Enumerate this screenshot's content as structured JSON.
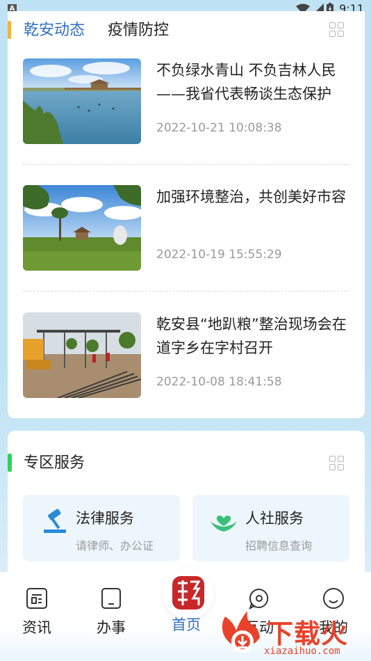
{
  "status_bar": {
    "notification_glyph": "A",
    "time": "9:11",
    "icons": [
      "wifi-icon",
      "signal-icon",
      "battery-icon"
    ]
  },
  "news": {
    "tabs": [
      {
        "label": "乾安动态",
        "active": true
      },
      {
        "label": "疫情防控",
        "active": false
      }
    ],
    "items": [
      {
        "title": "不负绿水青山 不负吉林人民——我省代表畅谈生态保护",
        "time": "2022-10-21 10:08:38",
        "thumb": "lake-scene"
      },
      {
        "title": "加强环境整治，共创美好市容",
        "time": "2022-10-19 15:55:29",
        "thumb": "park-pavilion"
      },
      {
        "title": "乾安县“地趴粮”整治现场会在道字乡在字村召开",
        "time": "2022-10-08 18:41:58",
        "thumb": "construction-site"
      }
    ]
  },
  "services": {
    "title": "专区服务",
    "tiles": [
      {
        "name": "法律服务",
        "desc": "请律师、办公证",
        "icon": "gavel-icon"
      },
      {
        "name": "人社服务",
        "desc": "招聘信息查询",
        "icon": "heart-hands-icon"
      }
    ]
  },
  "bottom_nav": {
    "items": [
      {
        "label": "资讯",
        "icon": "news-icon",
        "active": false
      },
      {
        "label": "办事",
        "icon": "tablet-icon",
        "active": false
      },
      {
        "label": "首页",
        "icon": "emblem-icon",
        "active": true
      },
      {
        "label": "互动",
        "icon": "chat-icon",
        "active": false
      },
      {
        "label": "我的",
        "icon": "smile-icon",
        "active": false
      }
    ]
  },
  "watermark": {
    "brand": "下载火",
    "url": "xiazaihuo.com"
  },
  "colors": {
    "accent_blue": "#2f6fbf",
    "tab_marker": "#f5b335",
    "service_marker": "#2fd05a",
    "background": "#bfe3f4",
    "watermark_red": "#e9422b"
  }
}
